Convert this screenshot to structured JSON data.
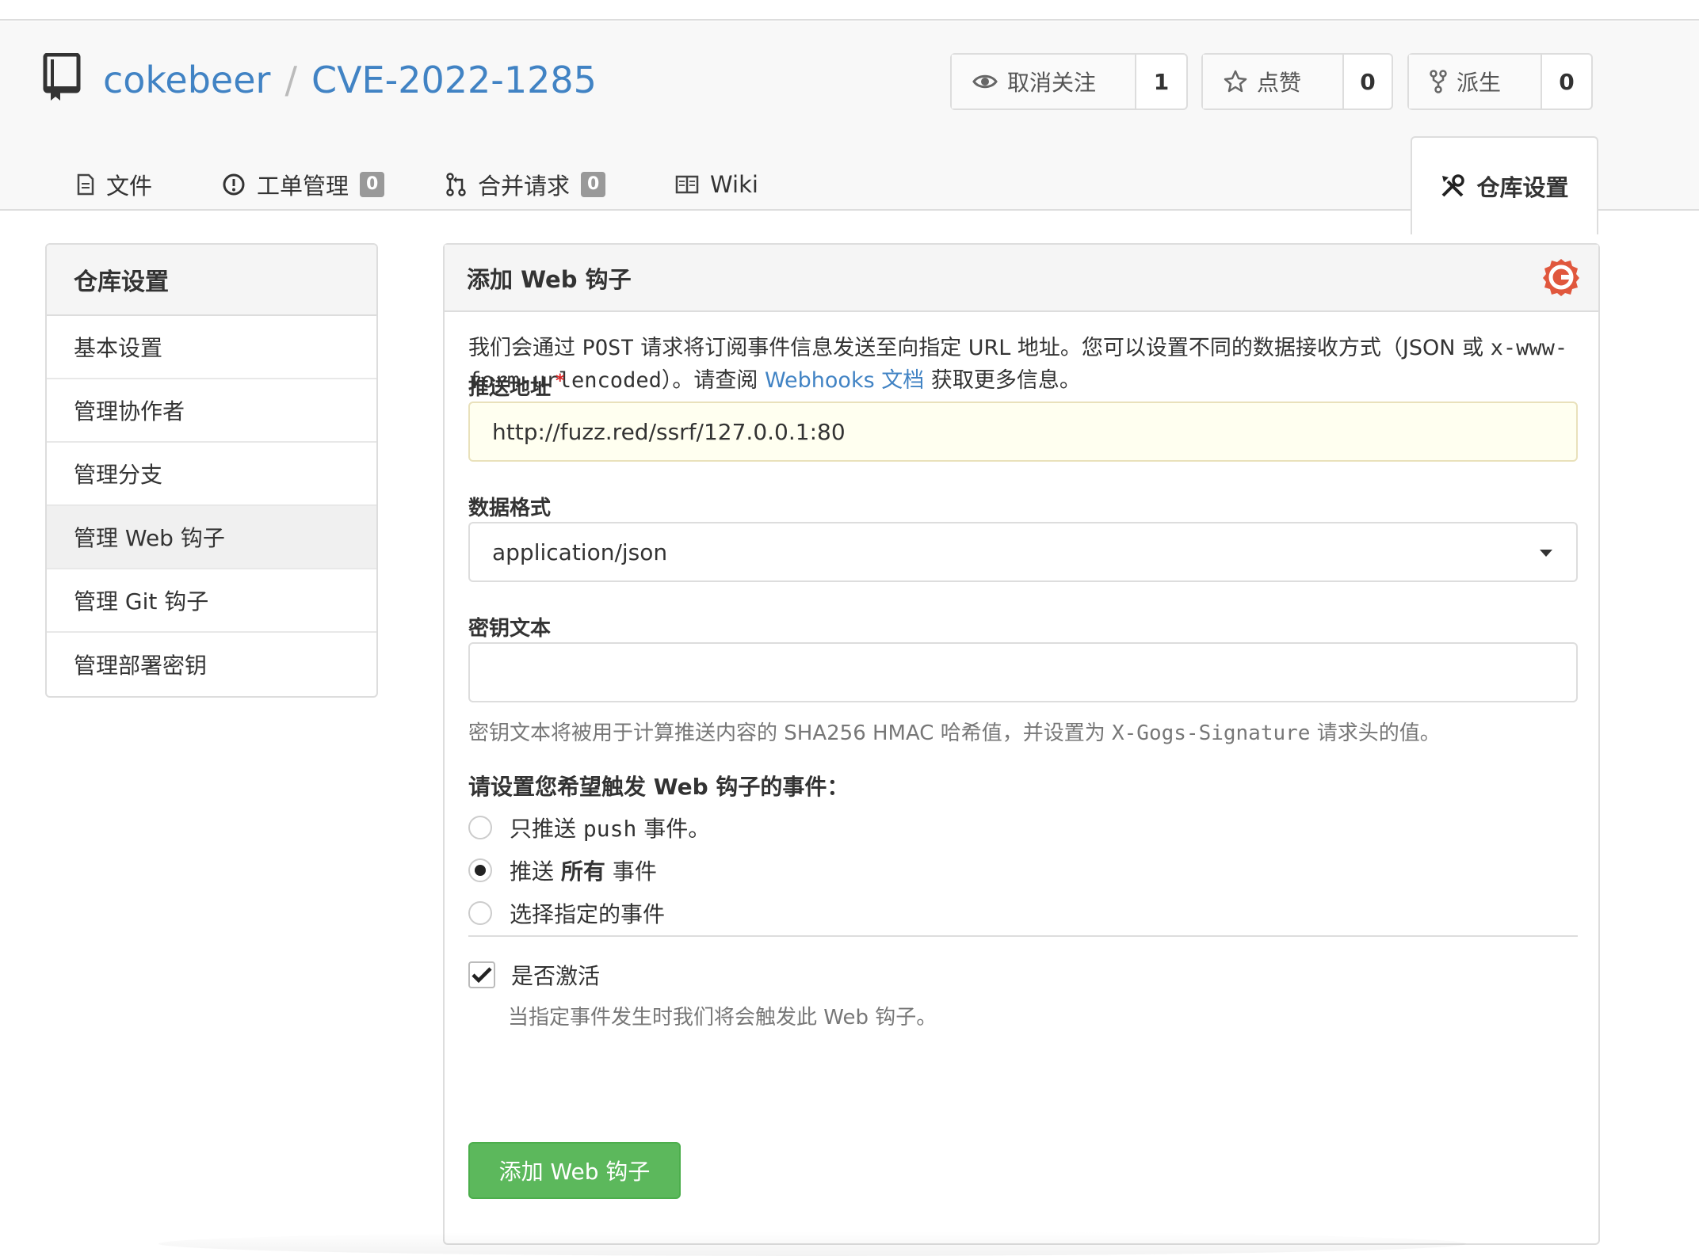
{
  "repo": {
    "owner": "cokebeer",
    "separator": "/",
    "name": "CVE-2022-1285"
  },
  "actions": {
    "watch": {
      "label": "取消关注",
      "count": "1",
      "icon": "eye-icon"
    },
    "star": {
      "label": "点赞",
      "count": "0",
      "icon": "star-icon"
    },
    "fork": {
      "label": "派生",
      "count": "0",
      "icon": "fork-icon"
    }
  },
  "tabs": [
    {
      "label": "文件",
      "icon": "file-icon"
    },
    {
      "label": "工单管理",
      "badge": "0",
      "icon": "issue-icon"
    },
    {
      "label": "合并请求",
      "badge": "0",
      "icon": "pull-request-icon"
    },
    {
      "label": "Wiki",
      "icon": "book-icon"
    },
    {
      "label": "仓库设置",
      "icon": "tools-icon",
      "active": true
    }
  ],
  "sidebar": {
    "title": "仓库设置",
    "items": [
      {
        "label": "基本设置"
      },
      {
        "label": "管理协作者"
      },
      {
        "label": "管理分支"
      },
      {
        "label": "管理 Web 钩子",
        "active": true
      },
      {
        "label": "管理 Git 钩子"
      },
      {
        "label": "管理部署密钥"
      }
    ]
  },
  "panel": {
    "title": "添加 Web 钩子",
    "desc_part1": "我们会通过 ",
    "desc_post": "POST",
    "desc_part2": " 请求将订阅事件信息发送至向指定 URL 地址。您可以设置不同的数据接收方式（JSON 或 ",
    "desc_mono": "x-www-form-urlencoded",
    "desc_part3": "）。请查阅 ",
    "desc_link": "Webhooks 文档",
    "desc_part4": " 获取更多信息。",
    "url_label": "推送地址",
    "url_required": "*",
    "url_value": "http://fuzz.red/ssrf/127.0.0.1:80",
    "format_label": "数据格式",
    "format_value": "application/json",
    "secret_label": "密钥文本",
    "secret_value": "",
    "secret_help_a": "密钥文本将被用于计算推送内容的 SHA256 HMAC 哈希值，并设置为 ",
    "secret_help_mono": "X-Gogs-Signature",
    "secret_help_b": " 请求头的值。",
    "events_question": "请设置您希望触发 Web 钩子的事件：",
    "events": {
      "push_only_a": "只推送 ",
      "push_only_mono": "push",
      "push_only_b": " 事件。",
      "all_a": "推送 ",
      "all_bold": "所有",
      "all_b": " 事件",
      "choose": "选择指定的事件"
    },
    "selected_event": "all",
    "active_label": "是否激活",
    "active_checked": true,
    "active_help": "当指定事件发生时我们将会触发此 Web 钩子。",
    "submit_label": "添加 Web 钩子"
  },
  "colors": {
    "link": "#4183c4",
    "submit": "#5cb85c",
    "required": "#db2828",
    "url_bg": "#fffff0"
  }
}
